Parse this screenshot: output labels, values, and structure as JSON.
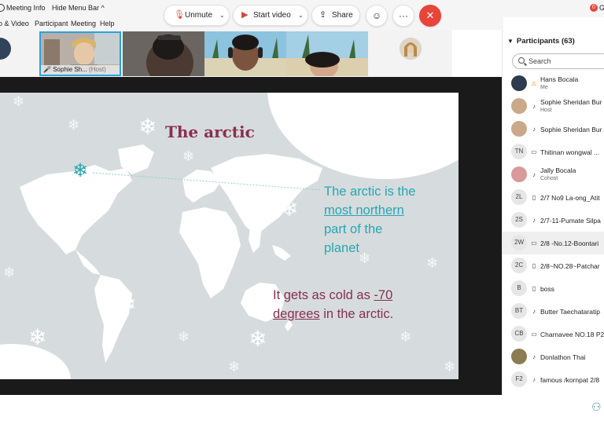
{
  "topbar": {
    "meeting_info": "Meeting Info",
    "hide_menu_bar": "Hide Menu Bar",
    "hide_chevron": "^",
    "rec_badge": "0",
    "rec_text": "G"
  },
  "menubar": {
    "items": [
      "o & Video",
      "Participant",
      "Meeting",
      "Help"
    ]
  },
  "video_strip": {
    "host_tile_name": "Sophie Sh...",
    "host_tag": "(Host)"
  },
  "slide": {
    "title": "The arctic",
    "text1_a": "The arctic is the",
    "text1_b": "most northern",
    "text1_c": "part of the",
    "text1_d": "planet",
    "text2_a": "It gets as cold as ",
    "text2_b": "-70",
    "text2_c": "degrees",
    "text2_d": " in the arctic.",
    "colors": {
      "title": "#8a2f4d",
      "teal": "#27a6b3",
      "bg": "#d6dcdd"
    }
  },
  "participants": {
    "header": "Participants (63)",
    "search_placeholder": "Search",
    "rows": [
      {
        "initials": "",
        "icon": "mic-icon",
        "name": "Hans Bocala",
        "role": "Me"
      },
      {
        "initials": "",
        "icon": "mic-icon",
        "name": "Sophie Sheridan Bur",
        "role": "Host"
      },
      {
        "initials": "",
        "icon": "mic-icon",
        "name": "Sophie Sheridan Bur",
        "role": ""
      },
      {
        "initials": "TN",
        "icon": "screen-icon",
        "name": "Thitinan wongwal ...",
        "role": ""
      },
      {
        "initials": "",
        "icon": "mic-icon",
        "name": "Jally Bocala",
        "role": "Cohost"
      },
      {
        "initials": "2L",
        "icon": "phone-icon",
        "name": "2/7 No9 La-ong_Atit",
        "role": ""
      },
      {
        "initials": "2S",
        "icon": "mic-icon",
        "name": "2/7-11-Pumate Silpa",
        "role": ""
      },
      {
        "initials": "2W",
        "icon": "screen-icon",
        "name": "2/8 -No.12-Boontari",
        "role": ""
      },
      {
        "initials": "2C",
        "icon": "phone-icon",
        "name": "2/8~NO.28~Patchar",
        "role": ""
      },
      {
        "initials": "B",
        "icon": "phone-icon",
        "name": "boss",
        "role": ""
      },
      {
        "initials": "BT",
        "icon": "mic-icon",
        "name": "Butter Taechataratip",
        "role": ""
      },
      {
        "initials": "CB",
        "icon": "screen-icon",
        "name": "Charnavee NO.18 P2",
        "role": ""
      },
      {
        "initials": "",
        "icon": "mic-icon",
        "name": "Donlathon Thai",
        "role": ""
      },
      {
        "initials": "F2",
        "icon": "mic-icon",
        "name": "famous /kornpat 2/8",
        "role": ""
      }
    ]
  },
  "controls": {
    "unmute": "Unmute",
    "start_video": "Start video",
    "share": "Share",
    "more": "···",
    "end": "✕"
  }
}
